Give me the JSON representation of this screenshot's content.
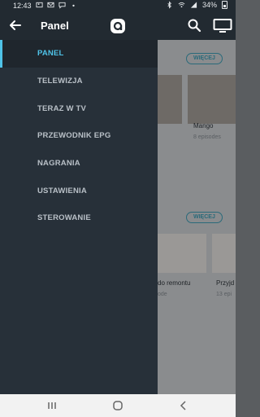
{
  "status_bar": {
    "time": "12:43",
    "battery": "34%"
  },
  "app_bar": {
    "title": "Panel"
  },
  "drawer": {
    "items": [
      {
        "label": "PANEL",
        "active": true
      },
      {
        "label": "TELEWIZJA",
        "active": false
      },
      {
        "label": "TERAZ W TV",
        "active": false
      },
      {
        "label": "PRZEWODNIK EPG",
        "active": false
      },
      {
        "label": "NAGRANIA",
        "active": false
      },
      {
        "label": "USTAWIENIA",
        "active": false
      },
      {
        "label": "STEROWANIE",
        "active": false
      }
    ]
  },
  "background": {
    "section1_more": "WIĘCEJ",
    "card1_title": "Mango",
    "card1_sub": "8 episodes",
    "section2_more": "WIĘCEJ",
    "card2_title": "do remontu",
    "card2_sub": "ode",
    "card3_title": "Przyjd",
    "card3_sub": "13 epi"
  },
  "colors": {
    "accent": "#4fc3e8",
    "drawer_bg": "#273039",
    "toolbar_bg": "#222a31"
  }
}
